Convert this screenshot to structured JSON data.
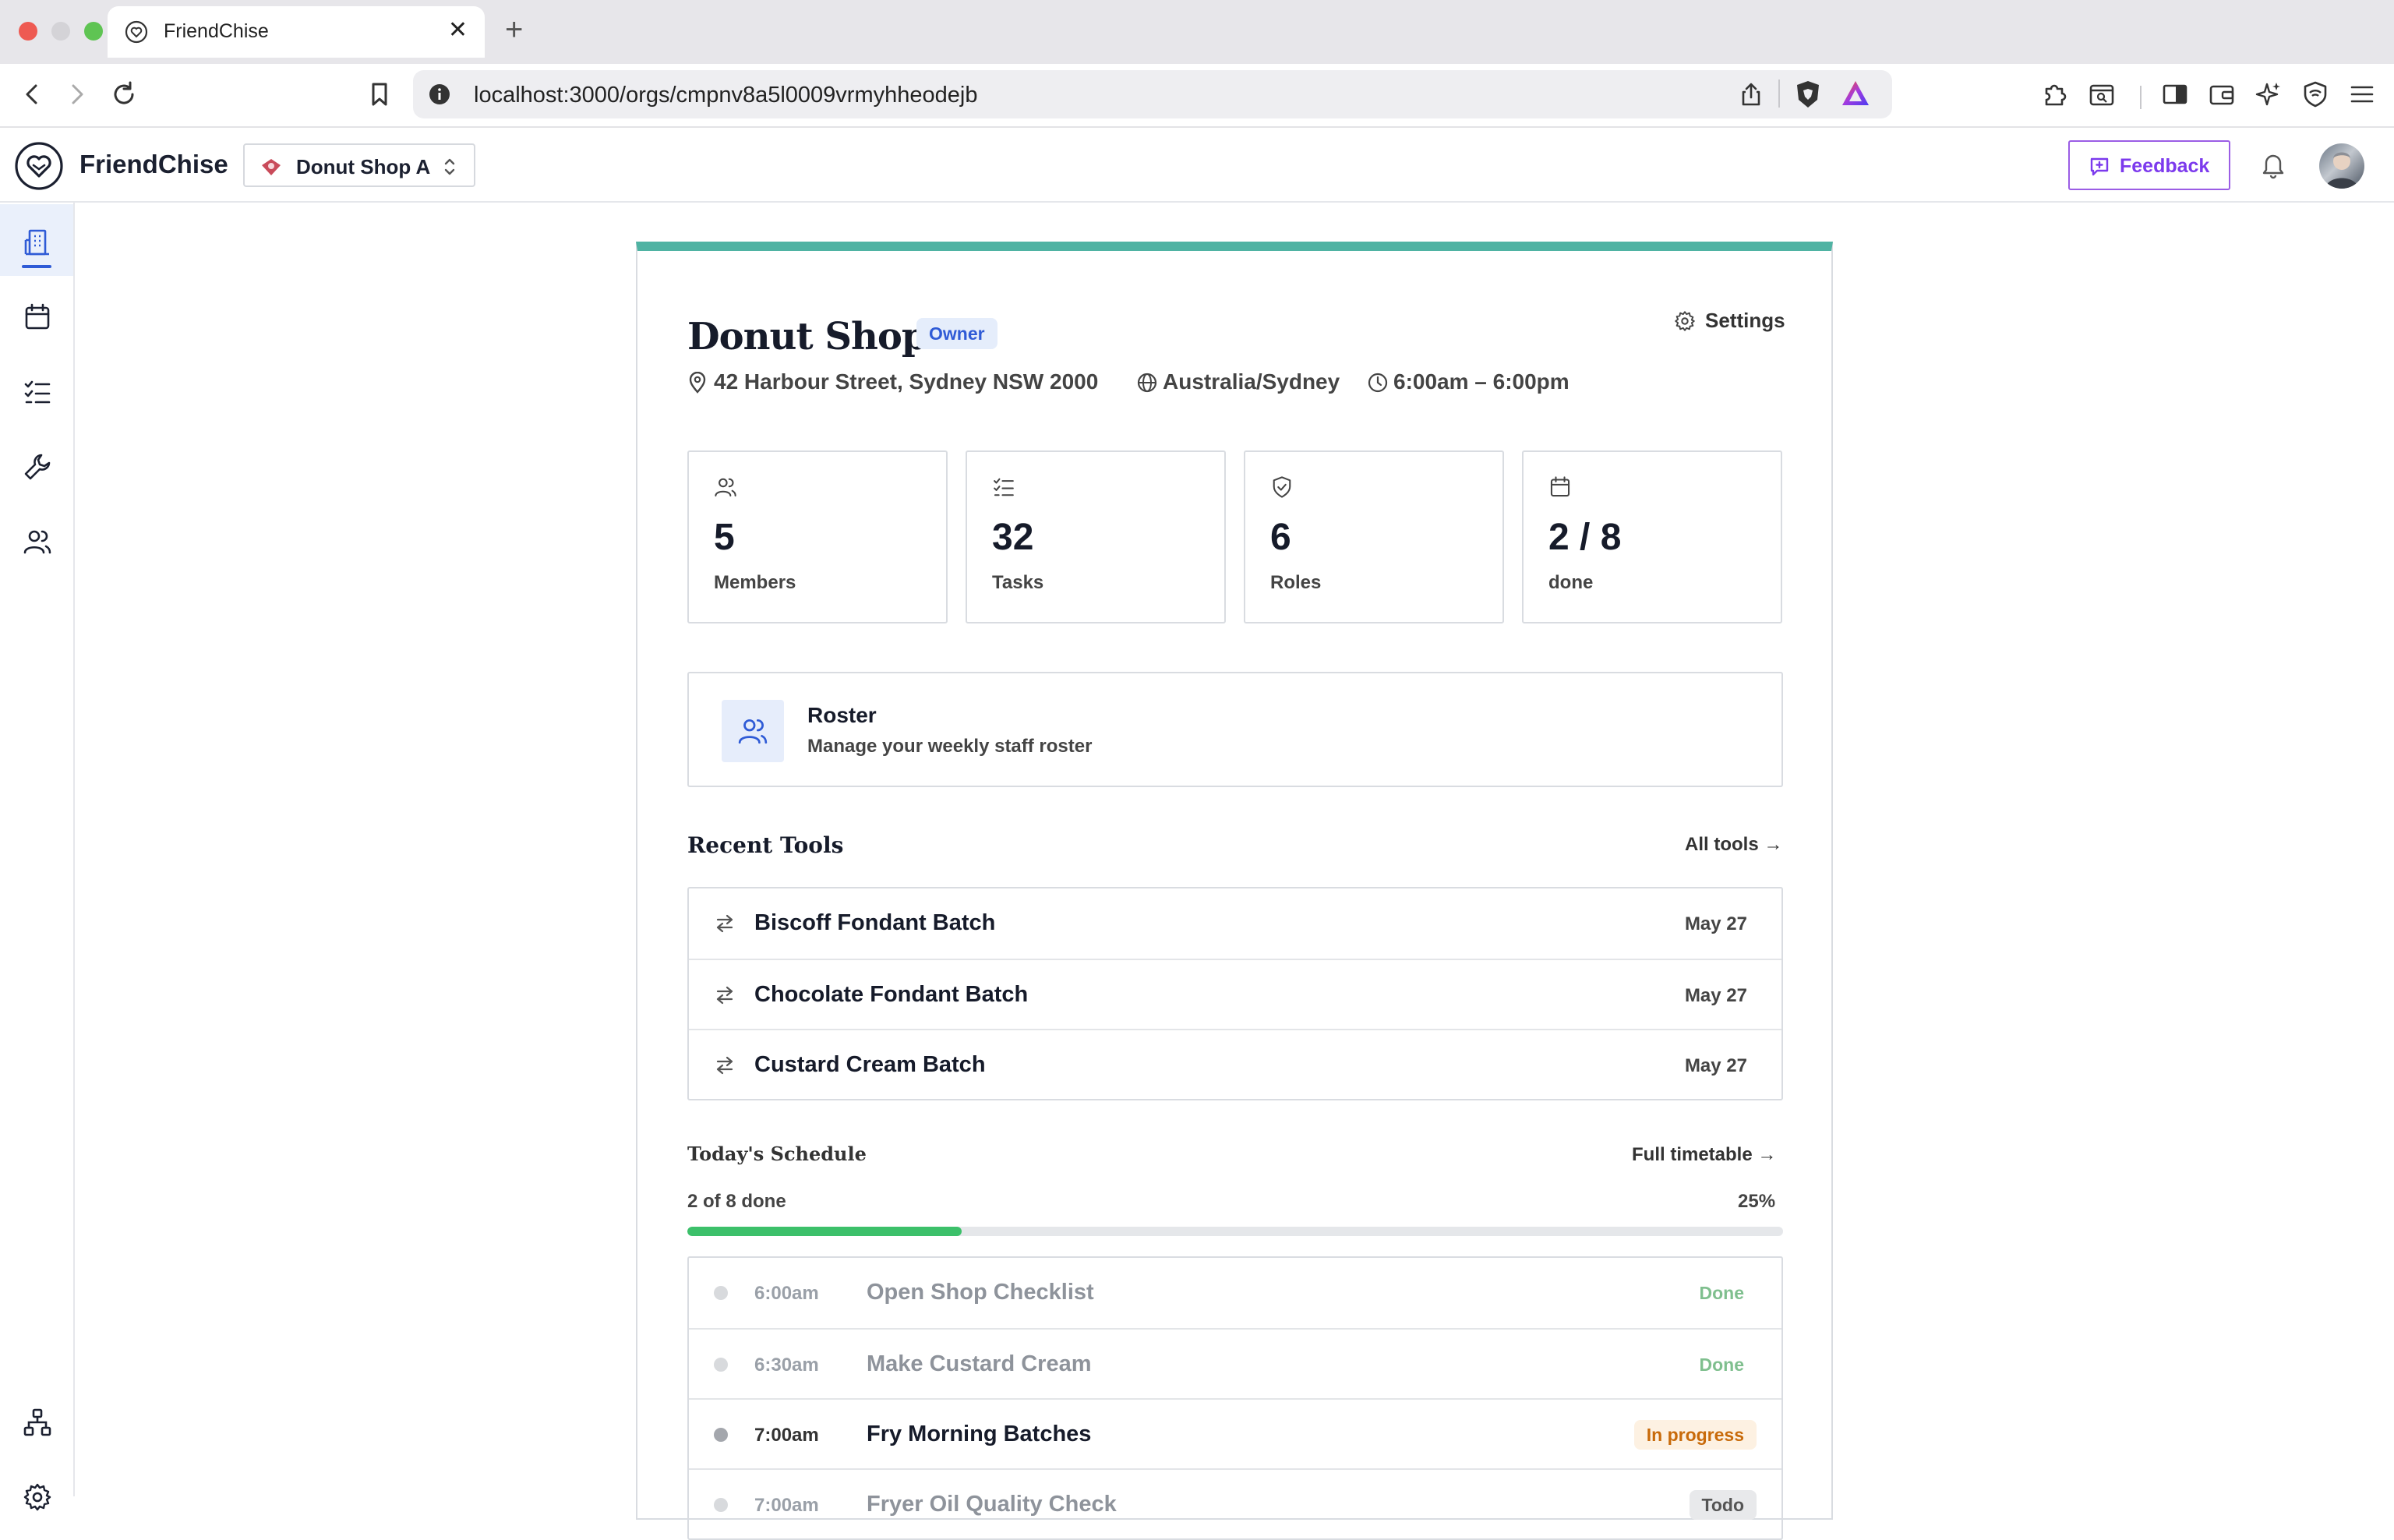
{
  "browser": {
    "tab_title": "FriendChise",
    "tab_close": "✕",
    "new_tab": "+",
    "url": "localhost:3000/orgs/cmpnv8a5l0009vrmyhheodejb"
  },
  "header": {
    "brand": "FriendChise",
    "org_name": "Donut Shop A",
    "feedback_label": "Feedback"
  },
  "shop": {
    "name": "Donut Shop A",
    "role_badge": "Owner",
    "settings_label": "Settings",
    "address": "42 Harbour Street, Sydney NSW 2000",
    "timezone": "Australia/Sydney",
    "hours": "6:00am – 6:00pm"
  },
  "stats": [
    {
      "icon": "users-icon",
      "value": "5",
      "label": "Members"
    },
    {
      "icon": "checklist-icon",
      "value": "32",
      "label": "Tasks"
    },
    {
      "icon": "shield-check-icon",
      "value": "6",
      "label": "Roles"
    },
    {
      "icon": "calendar-icon",
      "value": "2 / 8",
      "label": "done"
    }
  ],
  "roster": {
    "title": "Roster",
    "subtitle": "Manage your weekly staff roster"
  },
  "recent_tools": {
    "title": "Recent Tools",
    "link": "All tools →",
    "items": [
      {
        "name": "Biscoff Fondant Batch",
        "date": "May 27"
      },
      {
        "name": "Chocolate Fondant Batch",
        "date": "May 27"
      },
      {
        "name": "Custard Cream Batch",
        "date": "May 27"
      }
    ]
  },
  "schedule": {
    "title": "Today's Schedule",
    "link": "Full timetable →",
    "progress_label": "2 of 8 done",
    "progress_percent_label": "25%",
    "progress_fraction": 0.25,
    "items": [
      {
        "time": "6:00am",
        "name": "Open Shop Checklist",
        "status": "Done",
        "state": "done"
      },
      {
        "time": "6:30am",
        "name": "Make Custard Cream",
        "status": "Done",
        "state": "done"
      },
      {
        "time": "7:00am",
        "name": "Fry Morning Batches",
        "status": "In progress",
        "state": "active"
      },
      {
        "time": "7:00am",
        "name": "Fryer Oil Quality Check",
        "status": "Todo",
        "state": "todo"
      }
    ]
  },
  "colors": {
    "accent_bar": "#4fb3a3",
    "primary_blue": "#2f5bd6",
    "feedback_purple": "#7c3aed",
    "progress_green": "#3cc06a",
    "in_progress_orange": "#c86a0a"
  }
}
